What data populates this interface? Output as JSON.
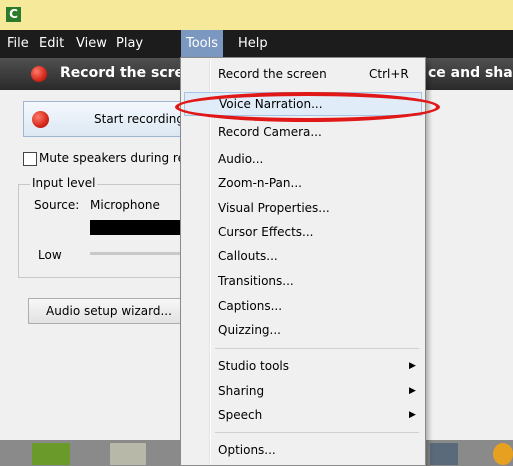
{
  "app": {
    "logo_letter": "C"
  },
  "menubar": {
    "items": [
      "File",
      "Edit",
      "View",
      "Play",
      "Tools",
      "Help"
    ],
    "active": "Tools"
  },
  "header": {
    "title_left": "Record the scree",
    "title_right": "ce and shar"
  },
  "panel": {
    "start_recording": "Start recording",
    "mute_label": "Mute speakers during rec",
    "input_level_title": "Input level",
    "source_label": "Source:",
    "source_value": "Microphone",
    "low_label": "Low",
    "audio_setup_wizard": "Audio setup wizard..."
  },
  "tools_menu": {
    "record_screen": {
      "label": "Record the screen",
      "shortcut": "Ctrl+R"
    },
    "voice_narration": "Voice Narration...",
    "record_camera": "Record Camera...",
    "audio": "Audio...",
    "zoom_n_pan": "Zoom-n-Pan...",
    "visual_properties": "Visual Properties...",
    "cursor_effects": "Cursor Effects...",
    "callouts": "Callouts...",
    "transitions": "Transitions...",
    "captions": "Captions...",
    "quizzing": "Quizzing...",
    "studio_tools": "Studio tools",
    "sharing": "Sharing",
    "speech": "Speech",
    "options": "Options..."
  },
  "colors": {
    "accent_red": "#e01818",
    "menu_highlight": "#7a98c0",
    "titlebar": "#f7e99a"
  }
}
